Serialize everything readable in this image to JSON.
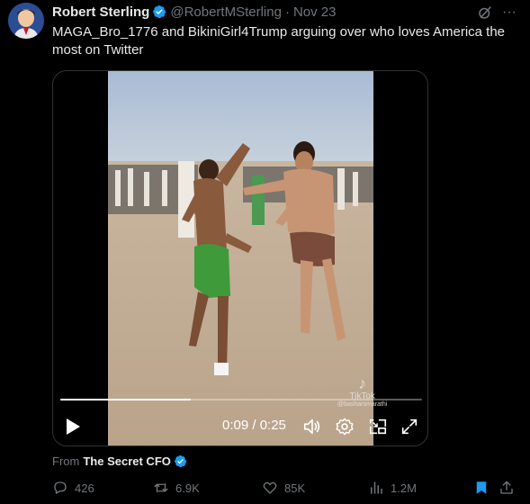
{
  "tweet": {
    "author_name": "Robert Sterling",
    "author_handle": "@RobertMSterling",
    "separator": "·",
    "date": "Nov 23",
    "text": "MAGA_Bro_1776 and BikiniGirl4Trump arguing over who loves America the most on Twitter",
    "more_label": "···"
  },
  "video": {
    "time_display": "0:09 / 0:25",
    "progress": 0.36,
    "watermark_brand": "TikTok",
    "watermark_handle": "@basharsmarathi"
  },
  "source": {
    "from_label": "From",
    "name": "The Secret CFO"
  },
  "actions": {
    "replies": "426",
    "retweets": "6.9K",
    "likes": "85K",
    "views": "1.2M"
  },
  "colors": {
    "verified": "#1d9bf0",
    "muted": "#71767b",
    "text": "#e7e9ea",
    "bookmark_active": "#1d9bf0"
  },
  "icons": {
    "verified": "verified-badge-icon",
    "grok": "grok-icon",
    "more": "more-icon",
    "play": "play-icon",
    "volume": "volume-icon",
    "settings": "gear-icon",
    "pip": "picture-in-picture-icon",
    "fullscreen": "fullscreen-icon",
    "reply": "reply-icon",
    "retweet": "retweet-icon",
    "like": "heart-icon",
    "views": "views-icon",
    "bookmark": "bookmark-icon",
    "share": "share-icon"
  }
}
